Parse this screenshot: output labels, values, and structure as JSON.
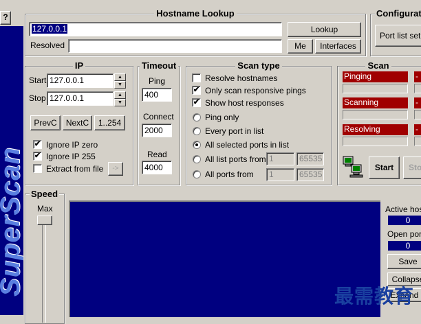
{
  "help_button": "?",
  "brand_vertical": "SuperScan",
  "hostname_lookup": {
    "title": "Hostname Lookup",
    "host_value": "127.0.0.1",
    "resolved_label": "Resolved",
    "resolved_value": "",
    "lookup_button": "Lookup",
    "me_button": "Me",
    "interfaces_button": "Interfaces"
  },
  "configuration": {
    "title": "Configurati",
    "port_list_button": "Port list setu"
  },
  "ip": {
    "title": "IP",
    "start_label": "Start",
    "start_value": "127.0.0.1",
    "stop_label": "Stop",
    "stop_value": "127.0.0.1",
    "prevc_button": "PrevC",
    "nextc_button": "NextC",
    "range_button": "1..254",
    "ignore_zero_label": "Ignore IP zero",
    "ignore_zero_checked": "✔",
    "ignore_255_label": "Ignore IP 255",
    "ignore_255_checked": "✔",
    "extract_label": "Extract from file",
    "extract_button": "->"
  },
  "timeout": {
    "title": "Timeout",
    "ping_label": "Ping",
    "ping_value": "400",
    "connect_label": "Connect",
    "connect_value": "2000",
    "read_label": "Read",
    "read_value": "4000"
  },
  "scan_type": {
    "title": "Scan type",
    "resolve_label": "Resolve hostnames",
    "responsive_label": "Only scan responsive pings",
    "responsive_checked": "✔",
    "show_host_label": "Show host responses",
    "show_host_checked": "✔",
    "ping_only_label": "Ping only",
    "every_port_label": "Every port in list",
    "all_selected_label": "All selected ports in list",
    "all_list_label": "All list ports from",
    "all_list_from": "1",
    "all_list_to": "65535",
    "all_ports_label": "All ports from",
    "all_ports_from": "1",
    "all_ports_to": "65535"
  },
  "scan": {
    "title": "Scan",
    "pinging_label": "Pinging",
    "scanning_label": "Scanning",
    "resolving_label": "Resolving",
    "dash": "-",
    "start_button": "Start",
    "stop_button": "Sto"
  },
  "speed": {
    "title": "Speed",
    "max_label": "Max"
  },
  "stats": {
    "active_hosts_label": "Active hos",
    "active_hosts_value": "0",
    "open_ports_label": "Open por",
    "open_ports_value": "0",
    "save_button": "Save",
    "collapse_button": "Collapse",
    "expand_button": "Expand a"
  },
  "watermark": "最需教育",
  "colors": {
    "face": "#d4d0c8",
    "brand_blue": "#000080",
    "results_blue": "#000080",
    "status_red": "#a00000",
    "selection": "#000080"
  }
}
